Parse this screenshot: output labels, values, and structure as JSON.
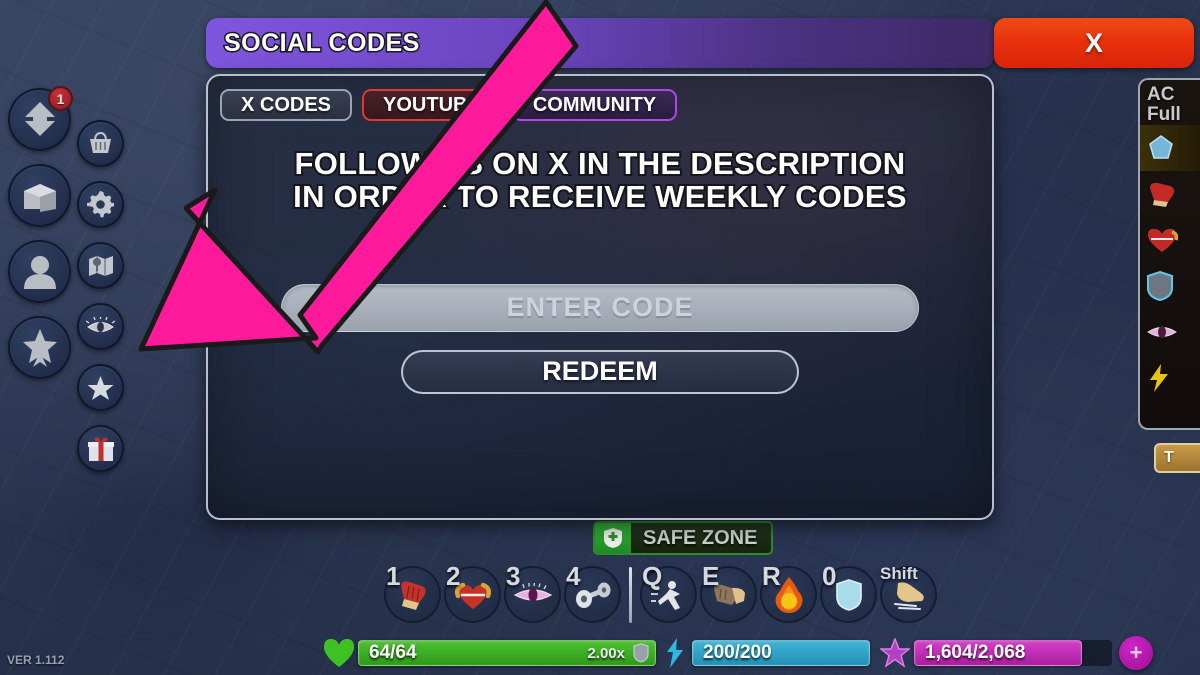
{
  "game": {
    "version_label": "VER 1.112",
    "background_color": "#2b3750"
  },
  "modal": {
    "title": "SOCIAL CODES",
    "close_label": "X",
    "accent_purple": "#7f55dd",
    "close_color": "#e7300c",
    "tabs": [
      {
        "label": "X CODES",
        "state": "active",
        "accent": "#9aa3b5"
      },
      {
        "label": "YOUTUBE",
        "state": "inactive",
        "accent": "#e0392f"
      },
      {
        "label": "COMMUNITY",
        "state": "inactive",
        "accent": "#b145e8"
      }
    ],
    "headline_line1": "FOLLOW US ON X IN THE DESCRIPTION",
    "headline_line2": "IN ORDER TO RECEIVE WEEKLY CODES",
    "code_input": {
      "value": "",
      "placeholder": "ENTER CODE"
    },
    "redeem_label": "REDEEM"
  },
  "sidebar": {
    "primary": [
      {
        "name": "upgrade-arrow-icon",
        "badge": "1"
      },
      {
        "name": "inventory-box-icon",
        "badge": ""
      },
      {
        "name": "profile-person-icon",
        "badge": ""
      },
      {
        "name": "star-rank-icon",
        "badge": ""
      }
    ],
    "secondary": [
      {
        "name": "shop-basket-icon"
      },
      {
        "name": "settings-gear-icon"
      },
      {
        "name": "map-icon"
      },
      {
        "name": "eye-icon"
      },
      {
        "name": "star-icon"
      },
      {
        "name": "gift-icon"
      }
    ]
  },
  "right_panel": {
    "title": "AC",
    "subtitle": "Full",
    "tag_label": "T",
    "rows": [
      {
        "name": "gem-icon",
        "selected": true
      },
      {
        "name": "fist-icon",
        "selected": false
      },
      {
        "name": "heart-icon",
        "selected": false
      },
      {
        "name": "shield-icon",
        "selected": false
      },
      {
        "name": "eye-icon",
        "selected": false
      },
      {
        "name": "bolt-icon",
        "selected": false
      }
    ]
  },
  "hud": {
    "safe_zone_label": "SAFE ZONE",
    "safe_zone_color": "#2f8a2b",
    "hotbar": [
      {
        "key": "1",
        "icon": "red-fist-icon"
      },
      {
        "key": "2",
        "icon": "muscle-heart-icon"
      },
      {
        "key": "3",
        "icon": "purple-eye-icon"
      },
      {
        "key": "4",
        "icon": "dumbbell-icon"
      },
      {
        "key": "Q",
        "icon": "dash-icon"
      },
      {
        "key": "E",
        "icon": "grab-hand-icon"
      },
      {
        "key": "R",
        "icon": "fireball-icon"
      },
      {
        "key": "0",
        "icon": "shield-icon"
      },
      {
        "key": "Shift",
        "icon": "sprint-foot-icon"
      }
    ],
    "bars": {
      "health": {
        "value": "64/64",
        "multiplier": "2.00x",
        "color": "#4cc22f"
      },
      "stamina": {
        "value": "200/200",
        "color": "#3fb6d6"
      },
      "experience": {
        "value": "1,604/2,068",
        "color": "#d63ec9"
      }
    },
    "add_button_label": "+"
  },
  "annotation": {
    "arrow_color": "#ff1a9b",
    "points_to": "star-icon"
  }
}
